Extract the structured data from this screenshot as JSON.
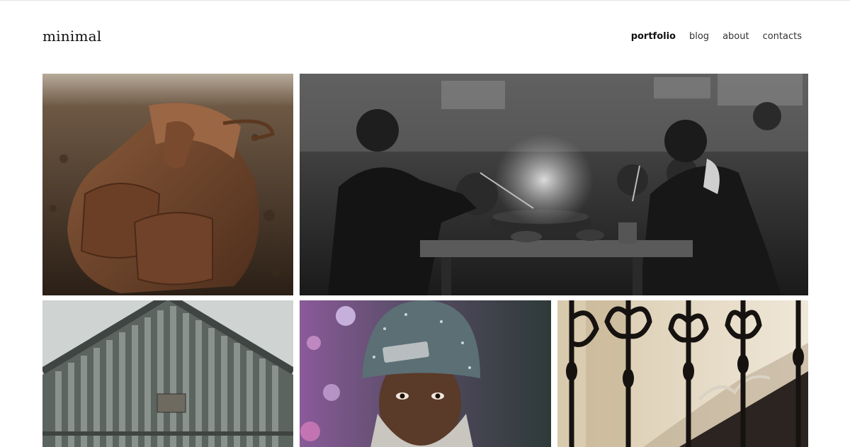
{
  "site": {
    "logo": "minimal"
  },
  "nav": {
    "items": [
      {
        "label": "portfolio",
        "active": true
      },
      {
        "label": "blog",
        "active": false
      },
      {
        "label": "about",
        "active": false
      },
      {
        "label": "contacts",
        "active": false
      }
    ]
  },
  "gallery": {
    "photos": [
      {
        "subject": "leather backpack on soil"
      },
      {
        "subject": "street food diners at a hot pot table"
      },
      {
        "subject": "wooden slatted gable"
      },
      {
        "subject": "man in snowy knit beanie"
      },
      {
        "subject": "ornate iron stair railing"
      }
    ]
  },
  "colors": {
    "background": "#ffffff",
    "text": "#222222",
    "active_nav": "#111111"
  }
}
